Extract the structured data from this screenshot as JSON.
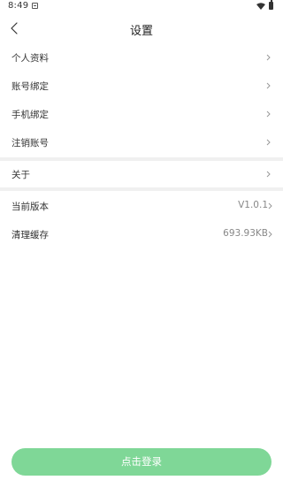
{
  "status_bar": {
    "time": "8:49",
    "icons": [
      "notification-icon",
      "wifi-icon",
      "battery-icon"
    ]
  },
  "header": {
    "title": "设置",
    "back_icon": "back-arrow-icon"
  },
  "groups": [
    {
      "items": [
        {
          "label": "个人资料",
          "value": ""
        },
        {
          "label": "账号绑定",
          "value": ""
        },
        {
          "label": "手机绑定",
          "value": ""
        },
        {
          "label": "注销账号",
          "value": ""
        }
      ]
    },
    {
      "items": [
        {
          "label": "关于",
          "value": ""
        }
      ]
    },
    {
      "items": [
        {
          "label": "当前版本",
          "value": "V1.0.1"
        },
        {
          "label": "清理缓存",
          "value": "693.93KB"
        }
      ]
    }
  ],
  "footer": {
    "login_label": "点击登录"
  },
  "colors": {
    "accent": "#7fd797",
    "divider": "#f0f0f0",
    "chevron": "#999999"
  }
}
